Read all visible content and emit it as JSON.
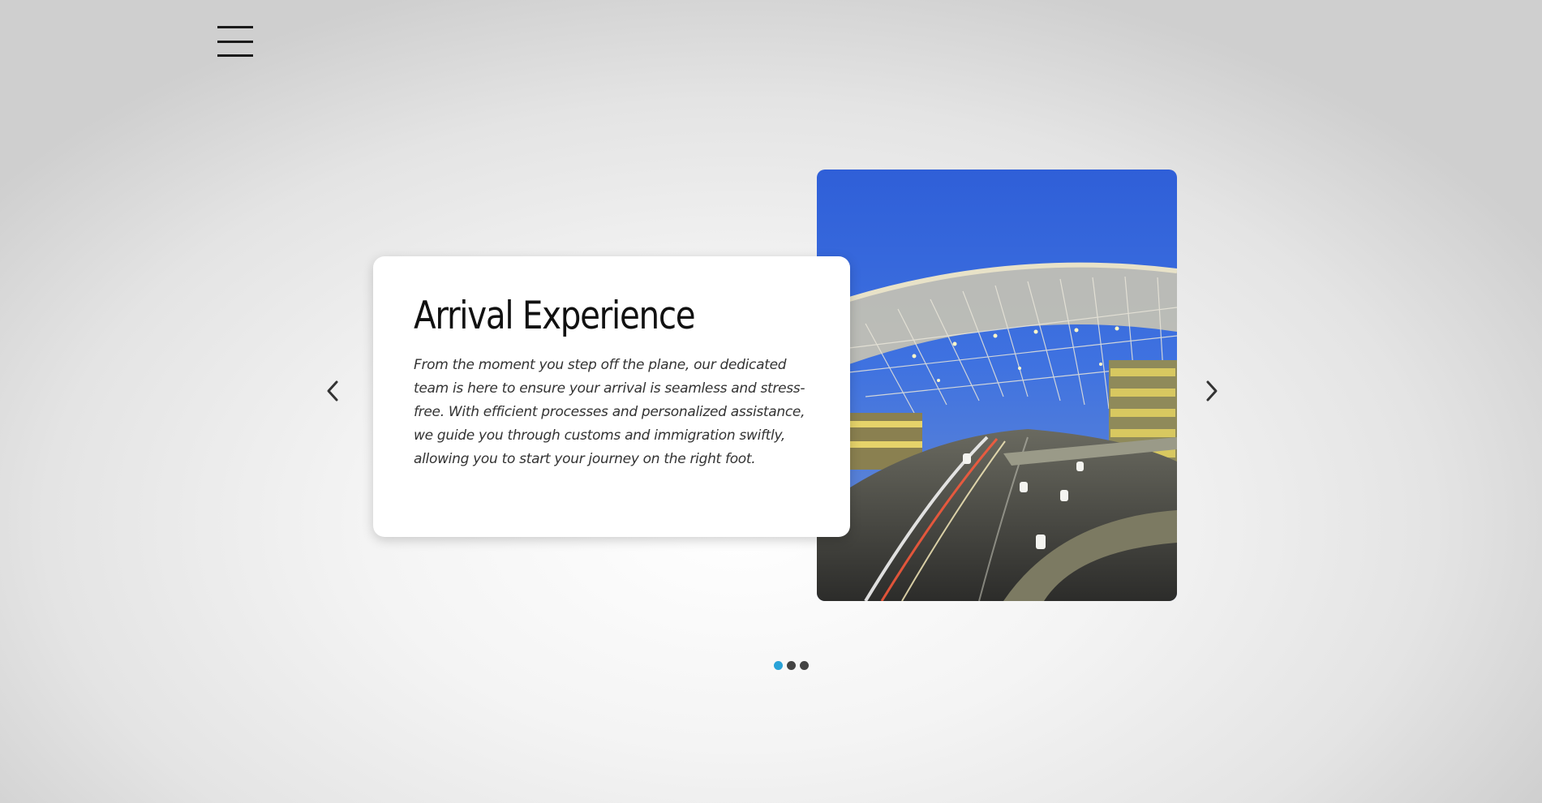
{
  "menu": {
    "icon": "hamburger-menu-icon"
  },
  "slider": {
    "slide": {
      "title": "Arrival Experience",
      "text": "From the moment you step off the plane, our dedicated team is here to ensure your arrival is seamless and stress-free. With efficient processes and personalized assistance, we guide you through customs and immigration swiftly, allowing you to start your journey on the right foot.",
      "image": "airport-terminal-photo"
    },
    "prev_icon": "chevron-left-icon",
    "next_icon": "chevron-right-icon",
    "dots": {
      "count": 3,
      "active_index": 0
    }
  },
  "colors": {
    "accent": "#2aa3d8",
    "dot_inactive": "#444444",
    "card_background": "#ffffff"
  }
}
